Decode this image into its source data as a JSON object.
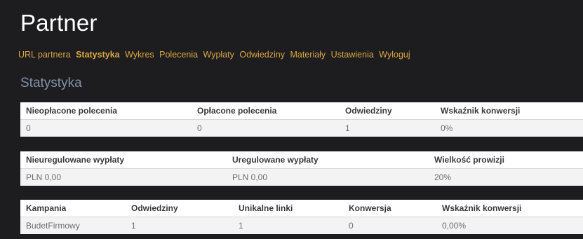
{
  "title": "Partner",
  "nav": [
    {
      "label": "URL partnera",
      "active": false
    },
    {
      "label": "Statystyka",
      "active": true
    },
    {
      "label": "Wykres",
      "active": false
    },
    {
      "label": "Polecenia",
      "active": false
    },
    {
      "label": "Wypłaty",
      "active": false
    },
    {
      "label": "Odwiedziny",
      "active": false
    },
    {
      "label": "Materiały",
      "active": false
    },
    {
      "label": "Ustawienia",
      "active": false
    },
    {
      "label": "Wyloguj",
      "active": false
    }
  ],
  "section_heading": "Statystyka",
  "tables": [
    {
      "headers": [
        "Nieopłacone polecenia",
        "Opłacone polecenia",
        "Odwiedziny",
        "Wskaźnik konwersji"
      ],
      "rows": [
        [
          "0",
          "0",
          "1",
          "0%"
        ]
      ]
    },
    {
      "headers": [
        "Nieuregulowane wypłaty",
        "Uregulowane wypłaty",
        "Wielkość prowizji"
      ],
      "rows": [
        [
          "PLN 0,00",
          "PLN 0,00",
          "20%"
        ]
      ]
    },
    {
      "headers": [
        "Kampania",
        "Odwiedziny",
        "Unikalne linki",
        "Konwersja",
        "Wskaźnik konwersji"
      ],
      "rows": [
        [
          "BudetFirmowy",
          "1",
          "1",
          "0",
          "0,00%"
        ]
      ]
    }
  ],
  "colors": {
    "background": "#1d1c1f",
    "nav_link": "#d9a640",
    "section_heading": "#8192a8",
    "header_row": "#ffffff",
    "data_row": "#f3f3f3"
  }
}
